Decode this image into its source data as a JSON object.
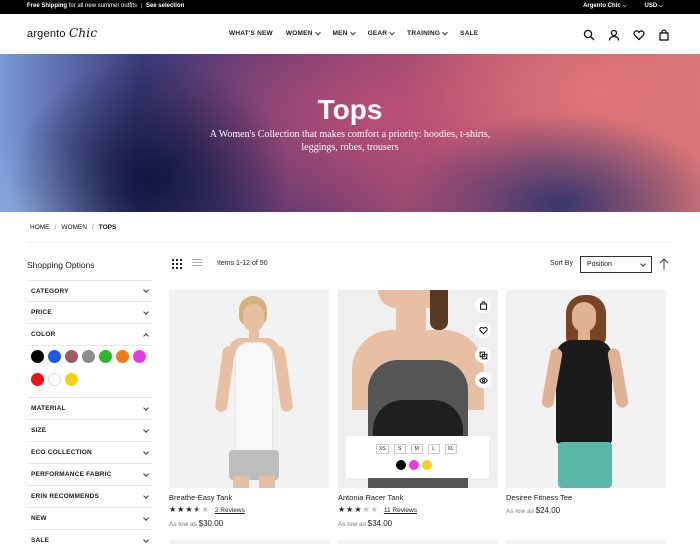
{
  "topbar": {
    "promo_bold": "Free Shipping",
    "promo_text": "for all new summer outfits",
    "promo_link": "See selection",
    "store": "Argento Chic",
    "currency": "USD"
  },
  "header": {
    "logo_a": "argento",
    "logo_b": "Chic",
    "nav": [
      {
        "label": "WHAT'S NEW",
        "caret": false
      },
      {
        "label": "WOMEN",
        "caret": true
      },
      {
        "label": "MEN",
        "caret": true
      },
      {
        "label": "GEAR",
        "caret": true
      },
      {
        "label": "TRAINING",
        "caret": true
      },
      {
        "label": "SALE",
        "caret": false
      }
    ],
    "icons": [
      "search-icon",
      "account-icon",
      "wishlist-icon",
      "cart-icon"
    ]
  },
  "hero": {
    "title": "Tops",
    "subtitle": "A Women's Collection that makes comfort a priority: hoodies, t-shirts, leggings, robes, trousers"
  },
  "breadcrumb": {
    "items": [
      "HOME",
      "WOMEN",
      "TOPS"
    ]
  },
  "sidebar": {
    "title": "Shopping Options",
    "filters_before": [
      "CATEGORY",
      "PRICE"
    ],
    "color_label": "COLOR",
    "colors": [
      "#000000",
      "#1f57e8",
      "#a05a63",
      "#8c8c8c",
      "#2fb52a",
      "#ee7a18",
      "#e43ce0",
      "#ee1111",
      "#ffffff",
      "#f5d21a"
    ],
    "filters_after": [
      "MATERIAL",
      "SIZE",
      "ECO COLLECTION",
      "PERFORMANCE FABRIC",
      "ERIN RECOMMENDS",
      "NEW",
      "SALE"
    ]
  },
  "toolbar": {
    "items_count": "Items 1-12 of 50",
    "sort_label": "Sort By",
    "sort_value": "Position"
  },
  "products": [
    {
      "name": "Breathe-Easy Tank",
      "rating": 3.5,
      "reviews": "2  Reviews",
      "price_prefix": "As low as",
      "price": "$30.00"
    },
    {
      "name": "Antonia Racer Tank",
      "rating": 3,
      "reviews": "11  Reviews",
      "price_prefix": "As low as",
      "price": "$34.00",
      "sizes": [
        "XS",
        "S",
        "M",
        "L",
        "XL"
      ],
      "swatches": [
        "#000000",
        "#e43ce0",
        "#f5d21a"
      ]
    },
    {
      "name": "Desiree Fitness Tee",
      "price_prefix": "As low as",
      "price": "$24.00"
    }
  ]
}
